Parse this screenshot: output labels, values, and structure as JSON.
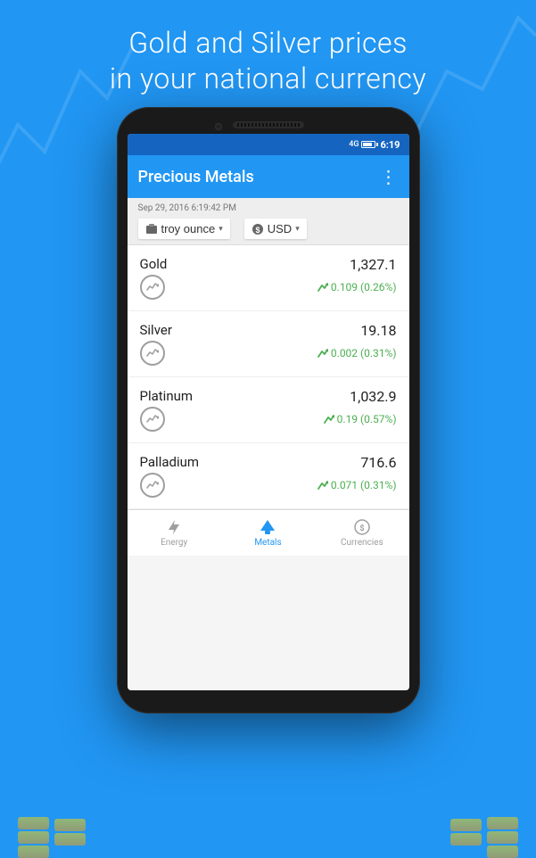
{
  "hero": {
    "line1": "Gold and Silver prices",
    "line2": "in your national currency"
  },
  "status_bar": {
    "signal": "4G",
    "time": "6:19"
  },
  "app_bar": {
    "title": "Precious Metals",
    "more_icon": "⋮"
  },
  "filter_bar": {
    "date": "Sep 29, 2016 6:19:42 PM",
    "unit_label": "troy ounce",
    "unit_icon": "weight",
    "currency_label": "USD",
    "currency_icon": "currency",
    "chevron": "▾"
  },
  "metals": [
    {
      "name": "Gold",
      "price": "1,327.1",
      "change": "0.109 (0.26%)",
      "trend": "up"
    },
    {
      "name": "Silver",
      "price": "19.18",
      "change": "0.002 (0.31%)",
      "trend": "up"
    },
    {
      "name": "Platinum",
      "price": "1,032.9",
      "change": "0.19 (0.57%)",
      "trend": "up"
    },
    {
      "name": "Palladium",
      "price": "716.6",
      "change": "0.071 (0.31%)",
      "trend": "up"
    }
  ],
  "bottom_nav": [
    {
      "id": "energy",
      "label": "Energy",
      "active": false
    },
    {
      "id": "metals",
      "label": "Metals",
      "active": true
    },
    {
      "id": "currencies",
      "label": "Currencies",
      "active": false
    }
  ]
}
